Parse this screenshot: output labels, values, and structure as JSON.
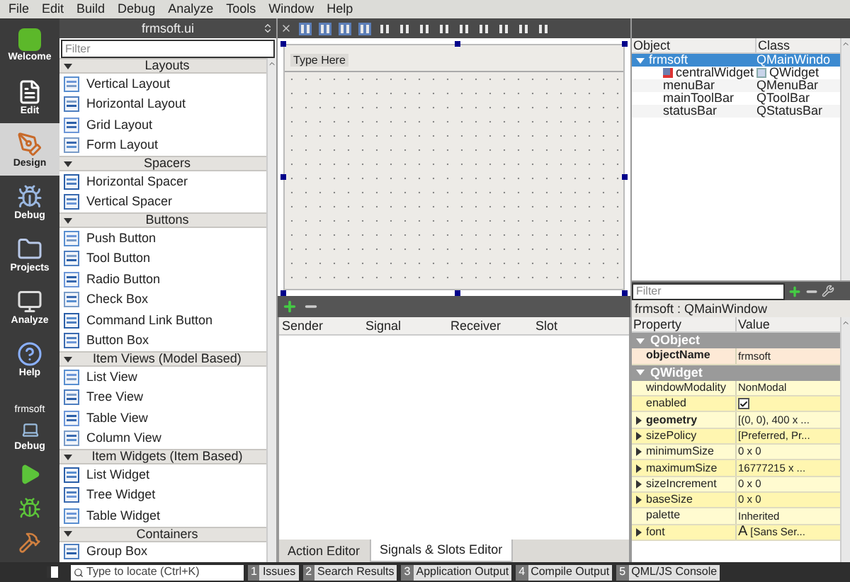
{
  "menu_bar": [
    "File",
    "Edit",
    "Build",
    "Debug",
    "Analyze",
    "Tools",
    "Window",
    "Help"
  ],
  "modes": [
    {
      "label": "Welcome",
      "selected": false
    },
    {
      "label": "Edit",
      "selected": false
    },
    {
      "label": "Design",
      "selected": true
    },
    {
      "label": "Debug",
      "selected": false
    },
    {
      "label": "Projects",
      "selected": false
    },
    {
      "label": "Analyze",
      "selected": false
    },
    {
      "label": "Help",
      "selected": false
    }
  ],
  "session": {
    "project": "frmsoft",
    "target": "Debug"
  },
  "widget_box": {
    "file": "frmsoft.ui",
    "filter_placeholder": "Filter",
    "sections": [
      {
        "title": "Layouts",
        "expanded": true,
        "items": [
          "Vertical Layout",
          "Horizontal Layout",
          "Grid Layout",
          "Form Layout"
        ]
      },
      {
        "title": "Spacers",
        "expanded": true,
        "items": [
          "Horizontal Spacer",
          "Vertical Spacer"
        ]
      },
      {
        "title": "Buttons",
        "expanded": true,
        "items": [
          "Push Button",
          "Tool Button",
          "Radio Button",
          "Check Box",
          "Command Link Button",
          "Button Box"
        ]
      },
      {
        "title": "Item Views (Model Based)",
        "expanded": true,
        "items": [
          "List View",
          "Tree View",
          "Table View",
          "Column View"
        ]
      },
      {
        "title": "Item Widgets (Item Based)",
        "expanded": true,
        "items": [
          "List Widget",
          "Tree Widget",
          "Table Widget"
        ]
      },
      {
        "title": "Containers",
        "expanded": true,
        "items": [
          "Group Box"
        ]
      }
    ]
  },
  "form": {
    "menu_placeholder": "Type Here"
  },
  "signals_editor": {
    "columns": [
      "Sender",
      "Signal",
      "Receiver",
      "Slot"
    ],
    "tabs": [
      {
        "label": "Action Editor",
        "selected": false
      },
      {
        "label": "Signals & Slots Editor",
        "selected": true
      }
    ]
  },
  "object_inspector": {
    "columns": [
      "Object",
      "Class"
    ],
    "tree": [
      {
        "object": "frmsoft",
        "class": "QMainWindo",
        "selected": true,
        "expanded": true,
        "children": [
          {
            "object": "centralWidget",
            "class": "QWidget",
            "selected": false
          },
          {
            "object": "menuBar",
            "class": "QMenuBar",
            "selected": false
          },
          {
            "object": "mainToolBar",
            "class": "QToolBar",
            "selected": false
          },
          {
            "object": "statusBar",
            "class": "QStatusBar",
            "selected": false
          }
        ]
      }
    ]
  },
  "property_editor": {
    "filter_placeholder": "Filter",
    "context": "frmsoft : QMainWindow",
    "columns": [
      "Property",
      "Value"
    ],
    "rows": [
      {
        "kind": "group",
        "name": "QObject",
        "expanded": true
      },
      {
        "kind": "text",
        "name": "objectName",
        "value": "frmsoft",
        "modified": true,
        "expandable": false
      },
      {
        "kind": "group",
        "name": "QWidget",
        "expanded": true
      },
      {
        "kind": "text",
        "name": "windowModality",
        "value": "NonModal",
        "modified": false,
        "expandable": false
      },
      {
        "kind": "checkbox",
        "name": "enabled",
        "checked": true,
        "modified": false,
        "expandable": false
      },
      {
        "kind": "text",
        "name": "geometry",
        "value": "[(0, 0), 400 x ...",
        "modified": true,
        "expandable": true
      },
      {
        "kind": "text",
        "name": "sizePolicy",
        "value": "[Preferred, Pr...",
        "modified": false,
        "expandable": true
      },
      {
        "kind": "text",
        "name": "minimumSize",
        "value": "0 x 0",
        "modified": false,
        "expandable": true
      },
      {
        "kind": "text",
        "name": "maximumSize",
        "value": "16777215 x ...",
        "modified": false,
        "expandable": true
      },
      {
        "kind": "text",
        "name": "sizeIncrement",
        "value": "0 x 0",
        "modified": false,
        "expandable": true
      },
      {
        "kind": "text",
        "name": "baseSize",
        "value": "0 x 0",
        "modified": false,
        "expandable": true
      },
      {
        "kind": "text",
        "name": "palette",
        "value": "Inherited",
        "modified": false,
        "expandable": false
      },
      {
        "kind": "font",
        "name": "font",
        "sample": "A",
        "value": "[Sans Ser...",
        "modified": false,
        "expandable": true
      }
    ]
  },
  "output_bar": {
    "locate_placeholder": "Type to locate (Ctrl+K)",
    "panes": [
      {
        "number": "1",
        "label": "Issues"
      },
      {
        "number": "2",
        "label": "Search Results"
      },
      {
        "number": "3",
        "label": "Application Output"
      },
      {
        "number": "4",
        "label": "Compile Output"
      },
      {
        "number": "5",
        "label": "QML/JS Console"
      }
    ]
  }
}
